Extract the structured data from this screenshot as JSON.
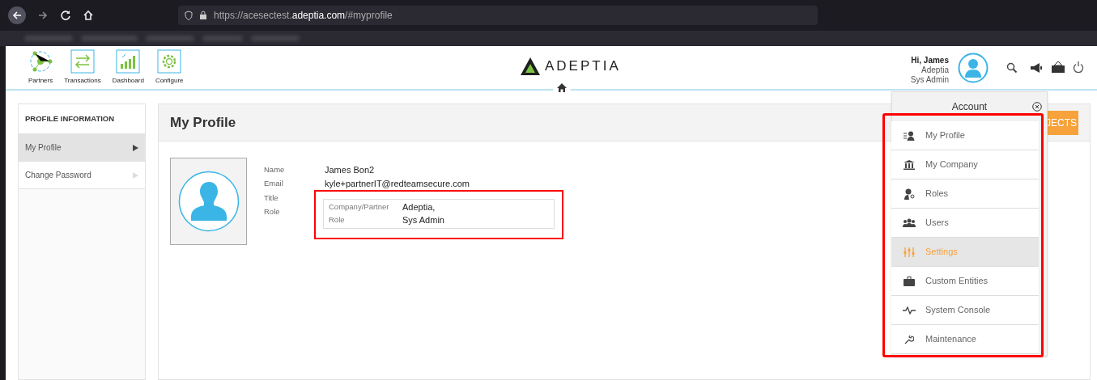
{
  "browser": {
    "url_prefix": "https://acesectest.",
    "url_domain": "adeptia.com",
    "url_suffix": "/#myprofile"
  },
  "nav": [
    {
      "label": "Partners",
      "kind": "partners"
    },
    {
      "label": "Transactions",
      "kind": "transactions"
    },
    {
      "label": "Dashboard",
      "kind": "dashboard"
    },
    {
      "label": "Configure",
      "kind": "configure"
    }
  ],
  "logo": "ADEPTIA",
  "user": {
    "greeting": "Hi, James",
    "company": "Adeptia",
    "role": "Sys Admin"
  },
  "sidebar": {
    "title": "PROFILE INFORMATION",
    "items": [
      {
        "label": "My Profile",
        "selected": true
      },
      {
        "label": "Change Password",
        "selected": false
      }
    ]
  },
  "main": {
    "title": "My Profile",
    "button": "JECTS",
    "fields": [
      {
        "label": "Name",
        "value": "James Bon2"
      },
      {
        "label": "Email",
        "value": "kyle+partnerIT@redteamsecure.com"
      },
      {
        "label": "Title"
      },
      {
        "label": "Role"
      }
    ],
    "role_table": [
      {
        "label": "Company/Partner",
        "value": "Adeptia,"
      },
      {
        "label": "Role",
        "value": "Sys Admin"
      }
    ]
  },
  "account_menu": {
    "title": "Account",
    "items": [
      {
        "label": "My Profile",
        "kind": "profile",
        "selected": false
      },
      {
        "label": "My Company",
        "kind": "company",
        "selected": false
      },
      {
        "label": "Roles",
        "kind": "roles",
        "selected": false
      },
      {
        "label": "Users",
        "kind": "users",
        "selected": false
      },
      {
        "label": "Settings",
        "kind": "settings",
        "selected": true
      },
      {
        "label": "Custom Entities",
        "kind": "entities",
        "selected": false
      },
      {
        "label": "System Console",
        "kind": "console",
        "selected": false
      },
      {
        "label": "Maintenance",
        "kind": "maintenance",
        "selected": false
      }
    ]
  }
}
